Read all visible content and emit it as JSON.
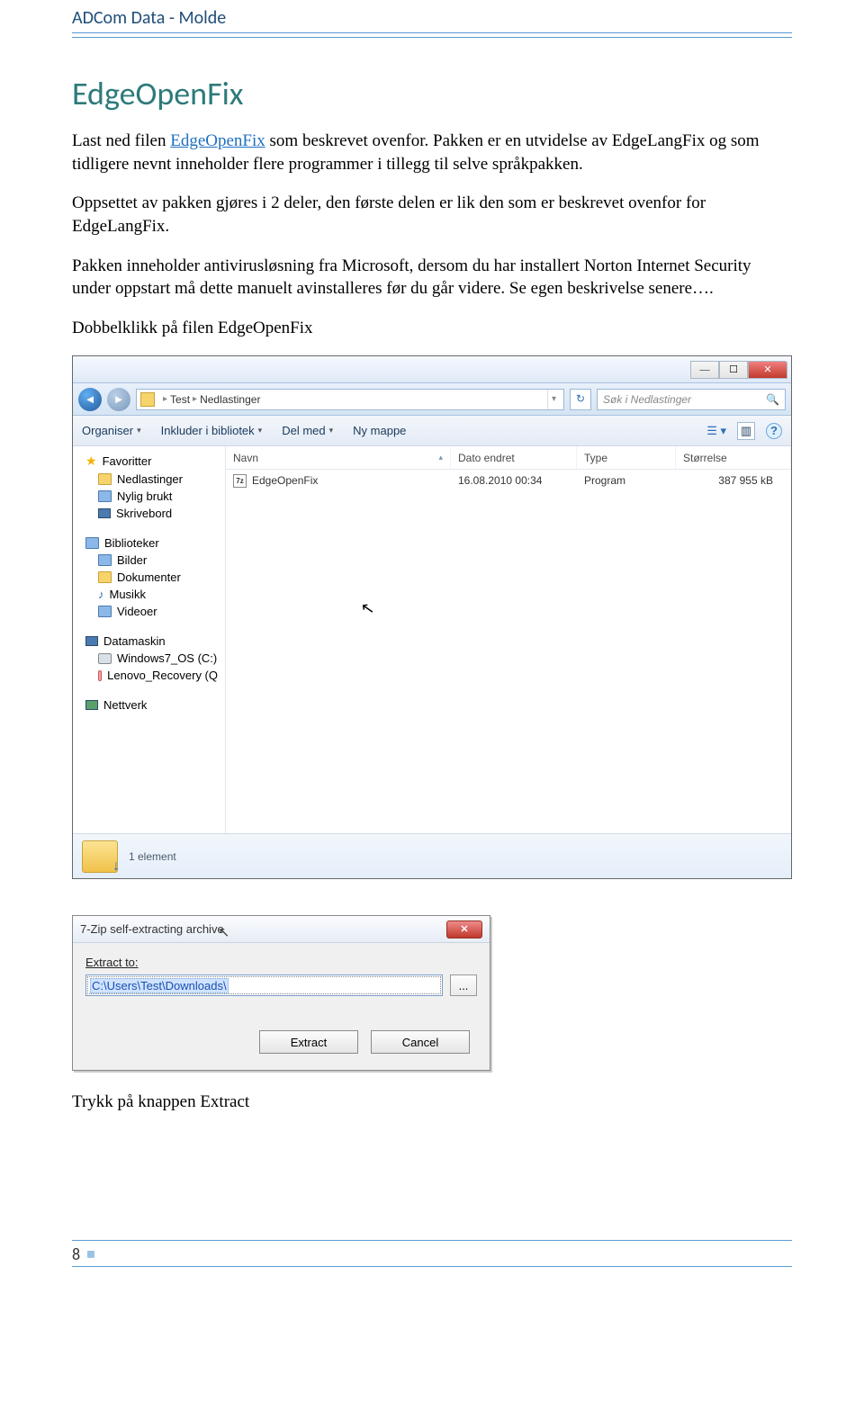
{
  "header": {
    "text": "ADCom Data - Molde"
  },
  "title": "EdgeOpenFix",
  "para1_a": "Last ned filen ",
  "para1_link": "EdgeOpenFix",
  "para1_b": " som beskrevet ovenfor. Pakken er en utvidelse av  EdgeLangFix og som tidligere nevnt inneholder flere programmer i tillegg til selve språkpakken.",
  "para2": "Oppsettet av pakken gjøres i 2 deler, den første delen er lik den som er beskrevet ovenfor for EdgeLangFix.",
  "para3": "Pakken inneholder antivirusløsning fra Microsoft, dersom du har installert Norton Internet Security under oppstart må dette manuelt avinstalleres før du går videre. Se egen beskrivelse senere….",
  "para4": "Dobbelklikk på filen EdgeOpenFix",
  "explorer": {
    "breadcrumb": {
      "seg1": "Test",
      "seg2": "Nedlastinger"
    },
    "search_placeholder": "Søk i Nedlastinger",
    "toolbar": {
      "organiser": "Organiser",
      "inkluder": "Inkluder i bibliotek",
      "del": "Del med",
      "ny": "Ny mappe"
    },
    "columns": {
      "name": "Navn",
      "date": "Dato endret",
      "type": "Type",
      "size": "Størrelse"
    },
    "row": {
      "name": "EdgeOpenFix",
      "date": "16.08.2010 00:34",
      "type": "Program",
      "size": "387 955 kB"
    },
    "tree": {
      "favoritter": "Favoritter",
      "nedlastinger": "Nedlastinger",
      "nylig": "Nylig brukt",
      "skrivebord": "Skrivebord",
      "biblioteker": "Biblioteker",
      "bilder": "Bilder",
      "dokumenter": "Dokumenter",
      "musikk": "Musikk",
      "videoer": "Videoer",
      "datamaskin": "Datamaskin",
      "drive1": "Windows7_OS (C:)",
      "drive2": "Lenovo_Recovery (Q",
      "nettverk": "Nettverk"
    },
    "status": "1 element"
  },
  "dialog": {
    "title": "7-Zip self-extracting archive",
    "label": "Extract to:",
    "path": "C:\\Users\\Test\\Downloads\\",
    "browse": "...",
    "extract": "Extract",
    "cancel": "Cancel"
  },
  "after_dialog": "Trykk på knappen Extract",
  "page_number": "8"
}
